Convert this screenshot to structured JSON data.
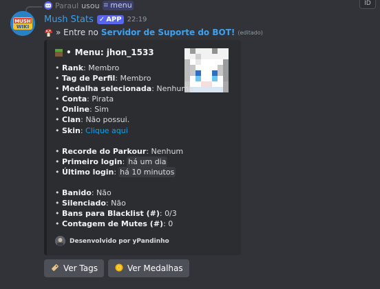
{
  "reply": {
    "user": "Paraul",
    "action": "usou",
    "command": "menu",
    "command_icon": "hash-icon"
  },
  "corner": {
    "label": "ID"
  },
  "message": {
    "author": "Mush Stats",
    "app_badge": "APP",
    "timestamp": "22:19",
    "avatar_text": [
      "MUSH",
      "WIKI"
    ],
    "content_prefix": "» Entre no",
    "content_highlight": "Servidor de Suporte do BOT!",
    "edited": "(editado)"
  },
  "embed": {
    "title": "Menu: jhon_1533",
    "title_icon": "grass-block-icon",
    "fields": [
      {
        "label": "Rank",
        "value": "Membro"
      },
      {
        "label": "Tag de Perfil",
        "value": "Membro"
      },
      {
        "label": "Medalha selecionada",
        "value": "Nenhuma"
      },
      {
        "label": "Conta",
        "value": "Pirata"
      },
      {
        "label": "Online",
        "value": "Sim"
      },
      {
        "label": "Clan",
        "value": "Não possui."
      },
      {
        "label": "Skin",
        "value": "Clique aqui"
      }
    ],
    "fields2": [
      {
        "label": "Recorde do Parkour",
        "value": "Nenhum"
      },
      {
        "label": "Primeiro login",
        "value": "há um dia"
      },
      {
        "label": "Último login",
        "value": "há 10 minutos"
      }
    ],
    "fields3": [
      {
        "label": "Banido",
        "value": "Não"
      },
      {
        "label": "Silenciado",
        "value": "Não"
      },
      {
        "label": "Bans para Blacklist (#)",
        "value": "0/3"
      },
      {
        "label": "Contagem de Mutes (#)",
        "value": "0"
      }
    ],
    "footer": "Desenvolvido por yPandinho"
  },
  "buttons": [
    {
      "label": "Ver Tags",
      "icon": "label-tag-icon"
    },
    {
      "label": "Ver Medalhas",
      "icon": "medal-icon"
    }
  ],
  "colors": {
    "background": "#313338",
    "embed_bg": "#2b2d31",
    "username": "#3aa0f0",
    "link": "#00a8fc",
    "app_badge": "#5865f2",
    "button_bg": "#4e5058"
  }
}
